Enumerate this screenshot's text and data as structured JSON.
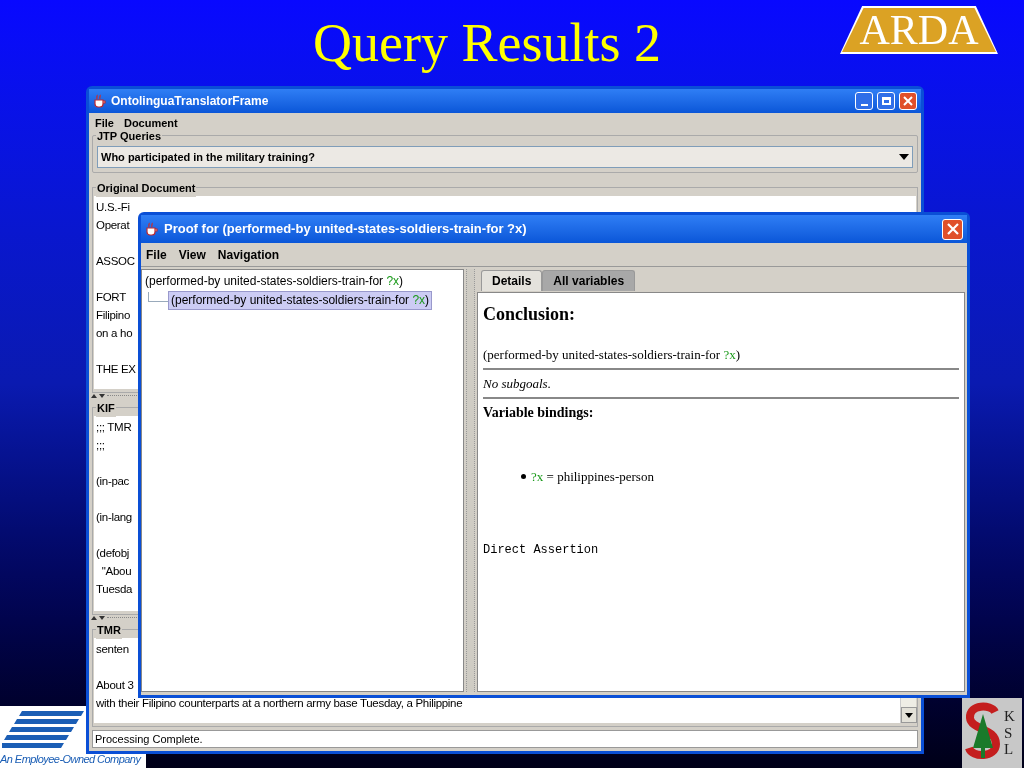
{
  "slide": {
    "title": "Query Results 2",
    "logo_top": "ARDA",
    "logo_bottom_left": "An Employee-Owned Company",
    "logo_bottom_right": "KSL"
  },
  "main_window": {
    "title": "OntolinguaTranslatorFrame",
    "menu": [
      "File",
      "Document"
    ],
    "queries": {
      "label": "JTP Queries",
      "value": "Who participated in the military training?"
    },
    "panels": [
      {
        "label": "Original Document",
        "paragraphs": [
          [
            "U.S.-Fi",
            "Operat"
          ],
          [
            "ASSOC"
          ],
          [
            "FORT",
            "Filipino",
            "on a ho"
          ],
          [
            "THE EX"
          ]
        ]
      },
      {
        "label": "KIF",
        "paragraphs": [
          [
            ";;; TMR",
            ";;;"
          ],
          [
            "(in-pac"
          ],
          [
            "(in-lang"
          ],
          [
            "(defobj",
            "  \"Abou",
            "Tuesda"
          ]
        ]
      },
      {
        "label": "TMR",
        "paragraphs": [
          [
            "senten"
          ],
          [
            "About 3",
            "with their Filipino counterparts at a northern army base Tuesday, a Philippine"
          ]
        ]
      }
    ],
    "status": "Processing Complete."
  },
  "proof_window": {
    "title": "Proof for (performed-by united-states-soldiers-train-for ?x)",
    "menu": [
      "File",
      "View",
      "Navigation"
    ],
    "tree": {
      "expr": "(performed-by united-states-soldiers-train-for ",
      "var": "?x",
      "close": ")",
      "selected": false,
      "children": [
        {
          "expr": "(performed-by united-states-soldiers-train-for ",
          "var": "?x",
          "close": ")",
          "selected": true
        }
      ]
    },
    "tabs": [
      {
        "label": "Details",
        "selected": true
      },
      {
        "label": "All variables",
        "selected": false
      }
    ],
    "details": {
      "heading": "Conclusion:",
      "conclusion": {
        "expr": "(performed-by united-states-soldiers-train-for ",
        "var": "?x",
        "close": ")"
      },
      "subgoals": "No subgoals.",
      "bindings_heading": "Variable bindings:",
      "bindings": [
        {
          "var": "?x",
          "op": "=",
          "value": "philippines-person"
        }
      ],
      "justification": "Direct Assertion"
    }
  }
}
